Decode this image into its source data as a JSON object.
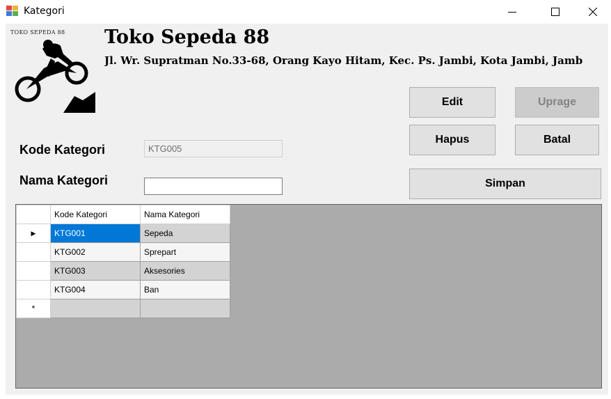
{
  "window": {
    "title": "Kategori",
    "controls": {
      "minimize": "minimize-icon",
      "maximize": "maximize-icon",
      "close": "close-icon"
    }
  },
  "header": {
    "logo_text": "TOKO SEPEDA 88",
    "shop_name": "Toko Sepeda 88",
    "address": "Jl. Wr. Supratman No.33-68, Orang Kayo Hitam, Kec. Ps. Jambi, Kota Jambi, Jamb"
  },
  "buttons": {
    "edit": "Edit",
    "uprage": "Uprage",
    "hapus": "Hapus",
    "batal": "Batal",
    "simpan": "Simpan"
  },
  "form": {
    "kode_label": "Kode Kategori",
    "kode_value": "KTG005",
    "nama_label": "Nama Kategori",
    "nama_value": ""
  },
  "grid": {
    "columns": [
      "Kode Kategori",
      "Nama Kategori"
    ],
    "rows": [
      {
        "kode": "KTG001",
        "nama": "Sepeda"
      },
      {
        "kode": "KTG002",
        "nama": "Sprepart"
      },
      {
        "kode": "KTG003",
        "nama": "Aksesories"
      },
      {
        "kode": "KTG004",
        "nama": "Ban"
      }
    ],
    "current_row_marker": "▶",
    "new_row_marker": "*"
  },
  "colors": {
    "selection": "#0078d7",
    "grid_background": "#ababab",
    "form_background": "#f0f0f0"
  }
}
